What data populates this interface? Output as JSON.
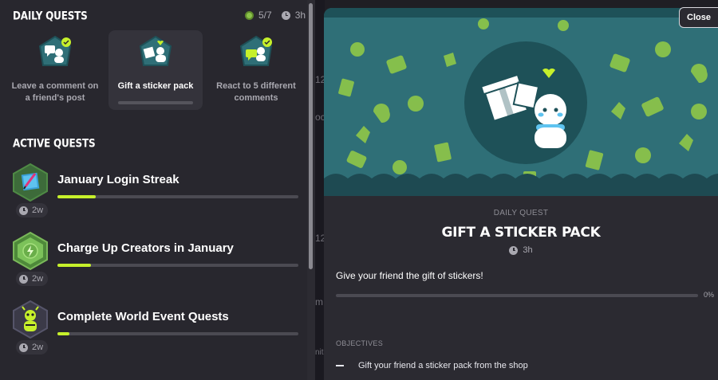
{
  "daily": {
    "title": "Daily Quests",
    "progress": "5/7",
    "time": "3h",
    "cards": [
      {
        "label": "Leave a comment on a friend's post",
        "icon": "comment-quest-icon",
        "progress": 0
      },
      {
        "label": "Gift a sticker pack",
        "icon": "gift-sticker-quest-icon",
        "progress": 0
      },
      {
        "label": "React to 5 different comments",
        "icon": "react-quest-icon",
        "progress": 0
      }
    ]
  },
  "active": {
    "title": "Active Quests",
    "quests": [
      {
        "title": "January Login Streak",
        "time": "2w",
        "progress": 0.16,
        "icon": "login-streak-badge-icon"
      },
      {
        "title": "Charge Up Creators in January",
        "time": "2w",
        "progress": 0.14,
        "icon": "charge-up-badge-icon"
      },
      {
        "title": "Complete World Event Quests",
        "time": "2w",
        "progress": 0.05,
        "icon": "world-event-badge-icon"
      }
    ]
  },
  "background": {
    "fragments": [
      "12",
      "oc",
      "12",
      "m",
      "nit"
    ]
  },
  "detail": {
    "close_label": "Close",
    "kind": "DAILY QUEST",
    "title": "GIFT A STICKER PACK",
    "time": "3h",
    "description": "Give your friend the gift of stickers!",
    "progress": 0,
    "percent": "0%",
    "objectives_label": "OBJECTIVES",
    "objectives": [
      "Gift your friend a sticker pack from the shop"
    ]
  },
  "colors": {
    "accent": "#c6f02b",
    "banner": "#2f6f77",
    "banner_pattern": "#8bc34a",
    "panel": "#28272e"
  }
}
